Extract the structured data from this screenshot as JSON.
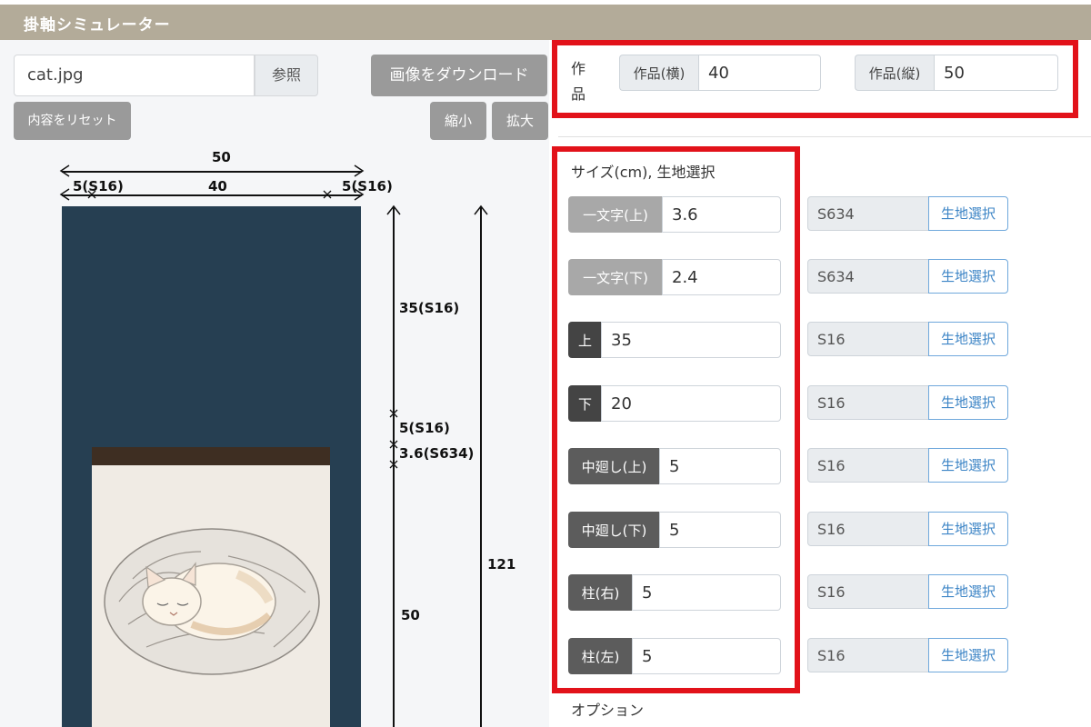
{
  "app": {
    "title": "掛軸シミュレーター"
  },
  "file": {
    "name": "cat.jpg",
    "browse_label": "参照"
  },
  "toolbar": {
    "download_label": "画像をダウンロード",
    "reset_label": "内容をリセット",
    "shrink_label": "縮小",
    "enlarge_label": "拡大"
  },
  "preview": {
    "total_width": "50",
    "left_margin": "5(S16)",
    "art_width": "40",
    "right_margin": "5(S16)",
    "top_label": "35(S16)",
    "naka_top_label": "5(S16)",
    "ichimonji_top_label": "3.6(S634)",
    "art_height": "50",
    "total_height": "121"
  },
  "work": {
    "label": "作品",
    "width_label": "作品(横)",
    "width_value": "40",
    "height_label": "作品(縦)",
    "height_value": "50"
  },
  "size_section": {
    "title": "サイズ(cm), 生地選択",
    "fabric_button_label": "生地選択",
    "rows": [
      {
        "label": "一文字(上)",
        "value": "3.6",
        "fabric": "S634"
      },
      {
        "label": "一文字(下)",
        "value": "2.4",
        "fabric": "S634"
      },
      {
        "label": "上",
        "value": "35",
        "fabric": "S16"
      },
      {
        "label": "下",
        "value": "20",
        "fabric": "S16"
      },
      {
        "label": "中廻し(上)",
        "value": "5",
        "fabric": "S16"
      },
      {
        "label": "中廻し(下)",
        "value": "5",
        "fabric": "S16"
      },
      {
        "label": "柱(右)",
        "value": "5",
        "fabric": "S16"
      },
      {
        "label": "柱(左)",
        "value": "5",
        "fabric": "S16"
      }
    ]
  },
  "options": {
    "title": "オプション"
  },
  "colors": {
    "highlight": "#e2121a",
    "header": "#b3ab99",
    "scroll_fabric": "#263f52",
    "fabric_link": "#3d85c6"
  }
}
